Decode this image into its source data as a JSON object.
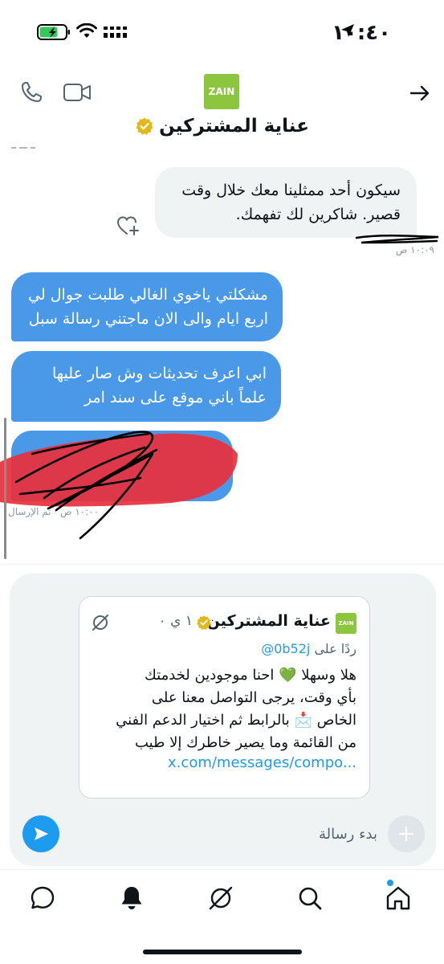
{
  "status_bar": {
    "time": "١٠:٤٠"
  },
  "header": {
    "avatar_text": "ZAIN",
    "title": "عناية المشتركين"
  },
  "messages": {
    "incoming": {
      "text": "سيكون أحد ممثلينا معك خلال وقت\nقصير. شاكرين لك تفهمك.",
      "timestamp": "١٠:٠٩ ص"
    },
    "outgoing": [
      {
        "text": "مشكلتي ياخوي الغالي طلبت جوال لي\nاربع ايام والى الان ماجتني رسالة سبل"
      },
      {
        "text": "ابي اعرف تحديثات وش صار عليها\nعلماً باني موقع على سند امر"
      }
    ],
    "outgoing_timestamp": "١٠:٠٠ ص · تم الإرسال"
  },
  "tweet_card": {
    "avatar_text": "ZAIN",
    "name": "عناية المشتركين",
    "time": "١ ي ٠",
    "reply_prefix": "ردًا على",
    "reply_handle": "@0b52j",
    "body": "هلا وسهلا 💚 احنا موجودين لخدمتك\nبأي وقت، يرجى التواصل معنا على\nالخاص 📩 بالرابط ثم اختيار الدعم الفني\nمن القائمة وما يصير خاطرك إلا طيب",
    "link": "x.com/messages/compo..."
  },
  "composer": {
    "placeholder": "بدء رسالة"
  },
  "colors": {
    "accent": "#1d9bf0",
    "outgoing_bubble": "#4a99e9",
    "incoming_bubble": "#eff3f4",
    "brand": "#8cc63f"
  },
  "icons": {
    "call": "phone-icon",
    "video": "video-icon",
    "back": "arrow-right-icon",
    "verified": "verified-badge-icon",
    "grok": "grok-icon",
    "send": "send-icon",
    "add": "plus-icon",
    "nav": [
      "messages-icon",
      "notifications-icon",
      "grok-icon",
      "search-icon",
      "home-icon"
    ]
  }
}
